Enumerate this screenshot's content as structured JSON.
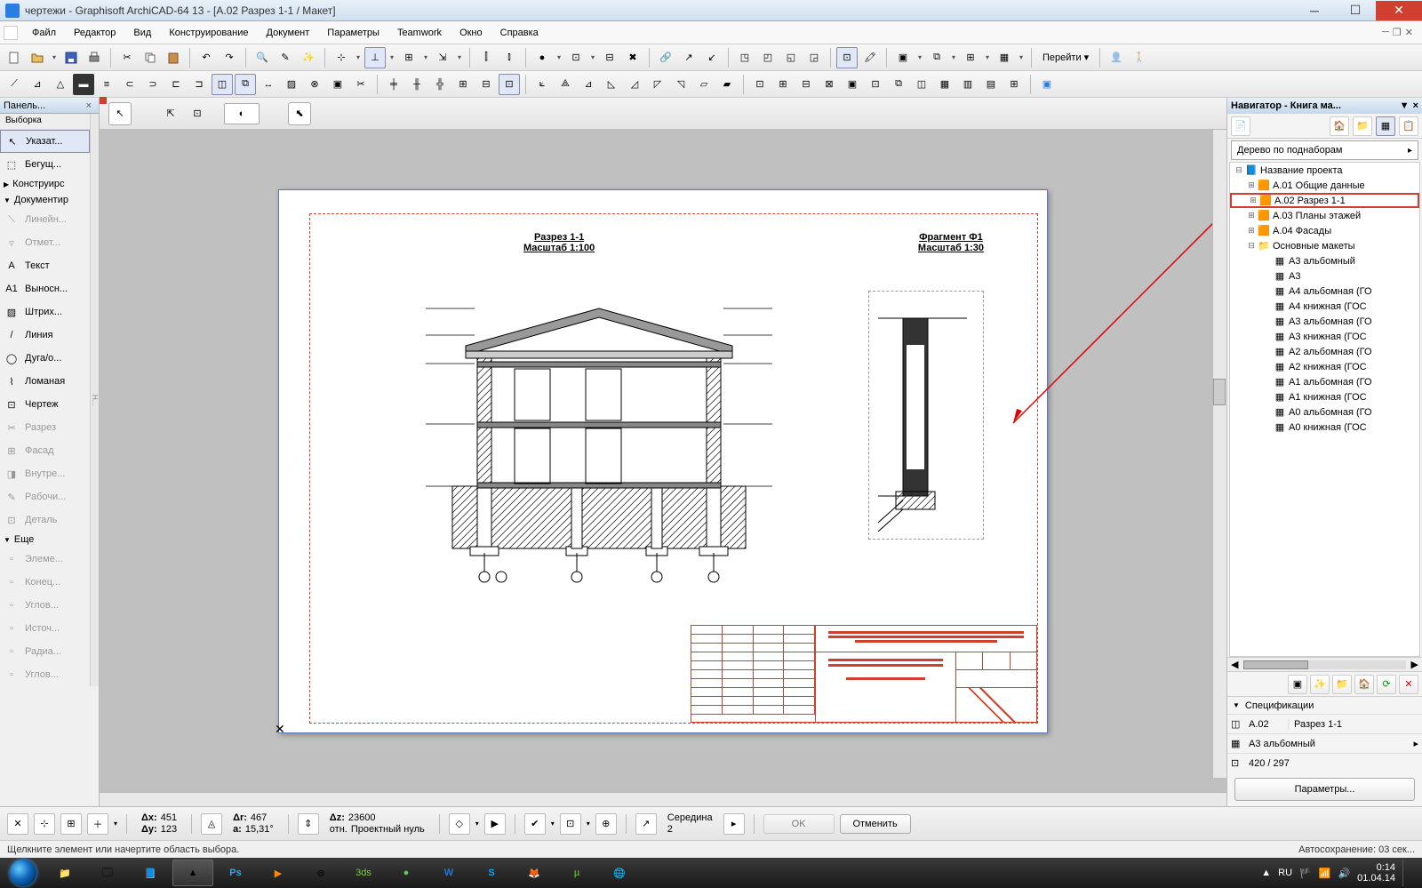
{
  "window": {
    "title": "чертежи - Graphisoft ArchiCAD-64 13 - [A.02 Разрез 1-1 / Макет]"
  },
  "menu": [
    "Файл",
    "Редактор",
    "Вид",
    "Конструирование",
    "Документ",
    "Параметры",
    "Teamwork",
    "Окно",
    "Справка"
  ],
  "go_label": "Перейти",
  "toolbox": {
    "title": "Панель...",
    "sub": "Выборка",
    "pointer": "Указат...",
    "marquee": "Бегущ...",
    "sections": {
      "construct": "Конструирс",
      "document": "Документир",
      "more": "Еще"
    },
    "doc_items": [
      {
        "label": "Линейн...",
        "dim": true
      },
      {
        "label": "Отмет...",
        "dim": true
      },
      {
        "label": "Текст",
        "dim": false
      },
      {
        "label": "Выносн...",
        "dim": false
      },
      {
        "label": "Штрих...",
        "dim": false
      },
      {
        "label": "Линия",
        "dim": false
      },
      {
        "label": "Дуга/о...",
        "dim": false
      },
      {
        "label": "Ломаная",
        "dim": false
      },
      {
        "label": "Чертеж",
        "dim": false
      },
      {
        "label": "Разрез",
        "dim": true
      },
      {
        "label": "Фасад",
        "dim": true
      },
      {
        "label": "Внутре...",
        "dim": true
      },
      {
        "label": "Рабочи...",
        "dim": true
      },
      {
        "label": "Деталь",
        "dim": true
      }
    ],
    "more_items": [
      {
        "label": "Элеме...",
        "dim": true
      },
      {
        "label": "Конец...",
        "dim": true
      },
      {
        "label": "Углов...",
        "dim": true
      },
      {
        "label": "Источ...",
        "dim": true
      },
      {
        "label": "Радиа...",
        "dim": true
      },
      {
        "label": "Углов...",
        "dim": true
      }
    ]
  },
  "drawing": {
    "section_title": "Разрез 1-1",
    "section_scale": "Масштаб 1:100",
    "fragment_title": "Фрагмент Ф1",
    "fragment_scale": "Масштаб 1:30"
  },
  "navigator": {
    "title": "Навигатор - Книга ма...",
    "dropdown": "Дерево по поднаборам",
    "tree": {
      "root": "Название проекта",
      "items": [
        {
          "label": "A.01 Общие данные",
          "highlight": false
        },
        {
          "label": "A.02 Разрез 1-1",
          "highlight": true
        },
        {
          "label": "A.03 Планы этажей",
          "highlight": false
        },
        {
          "label": "A.04 Фасады",
          "highlight": false
        }
      ],
      "masters_label": "Основные макеты",
      "masters": [
        "A3 альбомный",
        "A3",
        "A4 альбомная (ГО",
        "A4 книжная (ГОС",
        "A3 альбомная (ГО",
        "A3 книжная (ГОС",
        "A2 альбомная (ГО",
        "A2 книжная (ГОС",
        "A1 альбомная (ГО",
        "A1 книжная (ГОС",
        "A0 альбомная (ГО",
        "A0 книжная (ГОС"
      ]
    },
    "spec_header": "Спецификации",
    "spec_code": "A.02",
    "spec_name": "Разрез 1-1",
    "master_name": "A3 альбомный",
    "size": "420 / 297",
    "params_btn": "Параметры..."
  },
  "coords": {
    "dx_label": "Δx:",
    "dx": "451",
    "dy_label": "Δy:",
    "dy": "123",
    "dr_label": "Δr:",
    "dr": "467",
    "a_label": "a:",
    "a": "15,31°",
    "dz_label": "Δz:",
    "dz": "23600",
    "ref_label": "отн.",
    "ref": "Проектный нуль",
    "side_label": "Середина",
    "side_n": "2",
    "ok": "OK",
    "cancel": "Отменить"
  },
  "status": {
    "hint": "Щелкните элемент или начертите область выбора.",
    "autosave": "Автосохранение: 03 сек..."
  },
  "tray": {
    "lang": "RU",
    "time": "0:14",
    "date": "01.04.14"
  }
}
